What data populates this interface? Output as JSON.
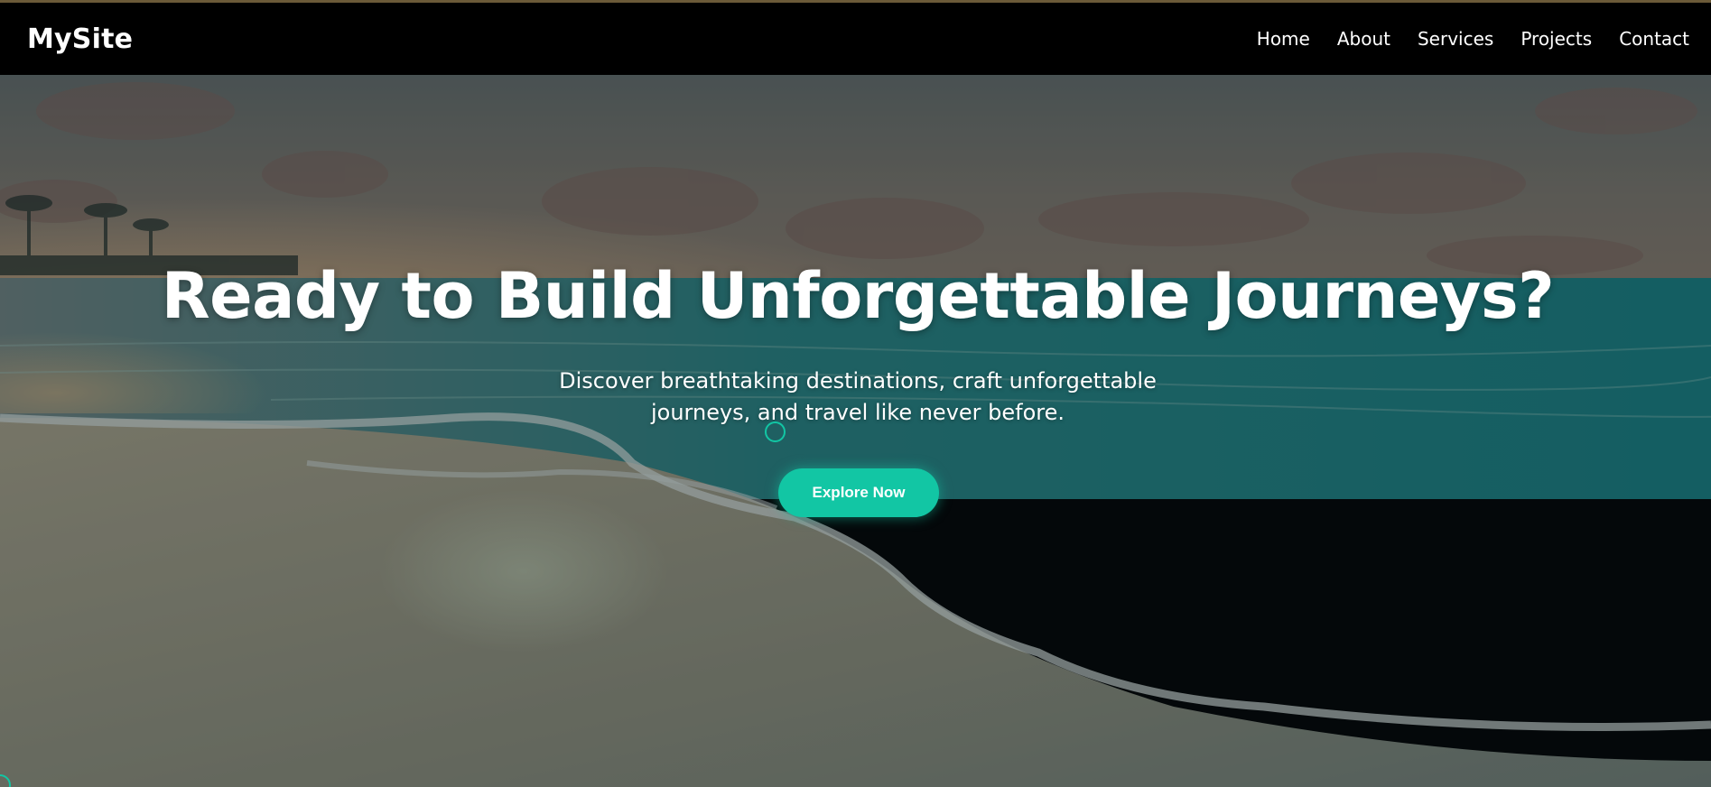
{
  "header": {
    "brand": "MySite",
    "nav": [
      {
        "label": "Home"
      },
      {
        "label": "About"
      },
      {
        "label": "Services"
      },
      {
        "label": "Projects"
      },
      {
        "label": "Contact"
      }
    ]
  },
  "hero": {
    "title": "Ready to Build Unforgettable Journeys?",
    "subtitle": "Discover breathtaking destinations, craft unforgettable journeys, and travel like never before.",
    "cta_label": "Explore Now",
    "background_image": "beach-sunset-image"
  },
  "colors": {
    "accent": "#12c6a4",
    "navbar_bg": "#000000",
    "text": "#ffffff"
  }
}
